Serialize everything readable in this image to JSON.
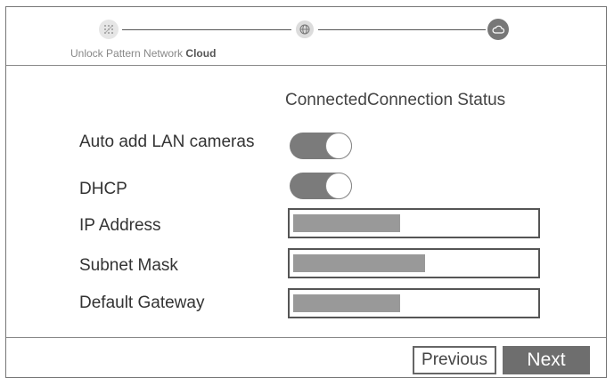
{
  "wizard": {
    "steps": [
      {
        "label": "Unlock Pattern",
        "icon": "lock-pattern-icon",
        "state": "done"
      },
      {
        "label": "Network",
        "icon": "globe-icon",
        "state": "done"
      },
      {
        "label": "Cloud",
        "icon": "cloud-icon",
        "state": "current"
      }
    ]
  },
  "status": {
    "text": "ConnectedConnection Status"
  },
  "settings": {
    "auto_add": {
      "label": "Auto add LAN cameras",
      "on": true
    },
    "dhcp": {
      "label": "DHCP",
      "on": true
    },
    "ip": {
      "label": "IP Address",
      "value_fill_fraction": 0.43
    },
    "subnet": {
      "label": "Subnet Mask",
      "value_fill_fraction": 0.53
    },
    "gateway": {
      "label": "Default Gateway",
      "value_fill_fraction": 0.43
    }
  },
  "footer": {
    "previous_label": "Previous",
    "next_label": "Next"
  },
  "colors": {
    "toggle_on": "#7b7b7b",
    "next_bg": "#6e6e6e",
    "field_fill": "#999999"
  }
}
